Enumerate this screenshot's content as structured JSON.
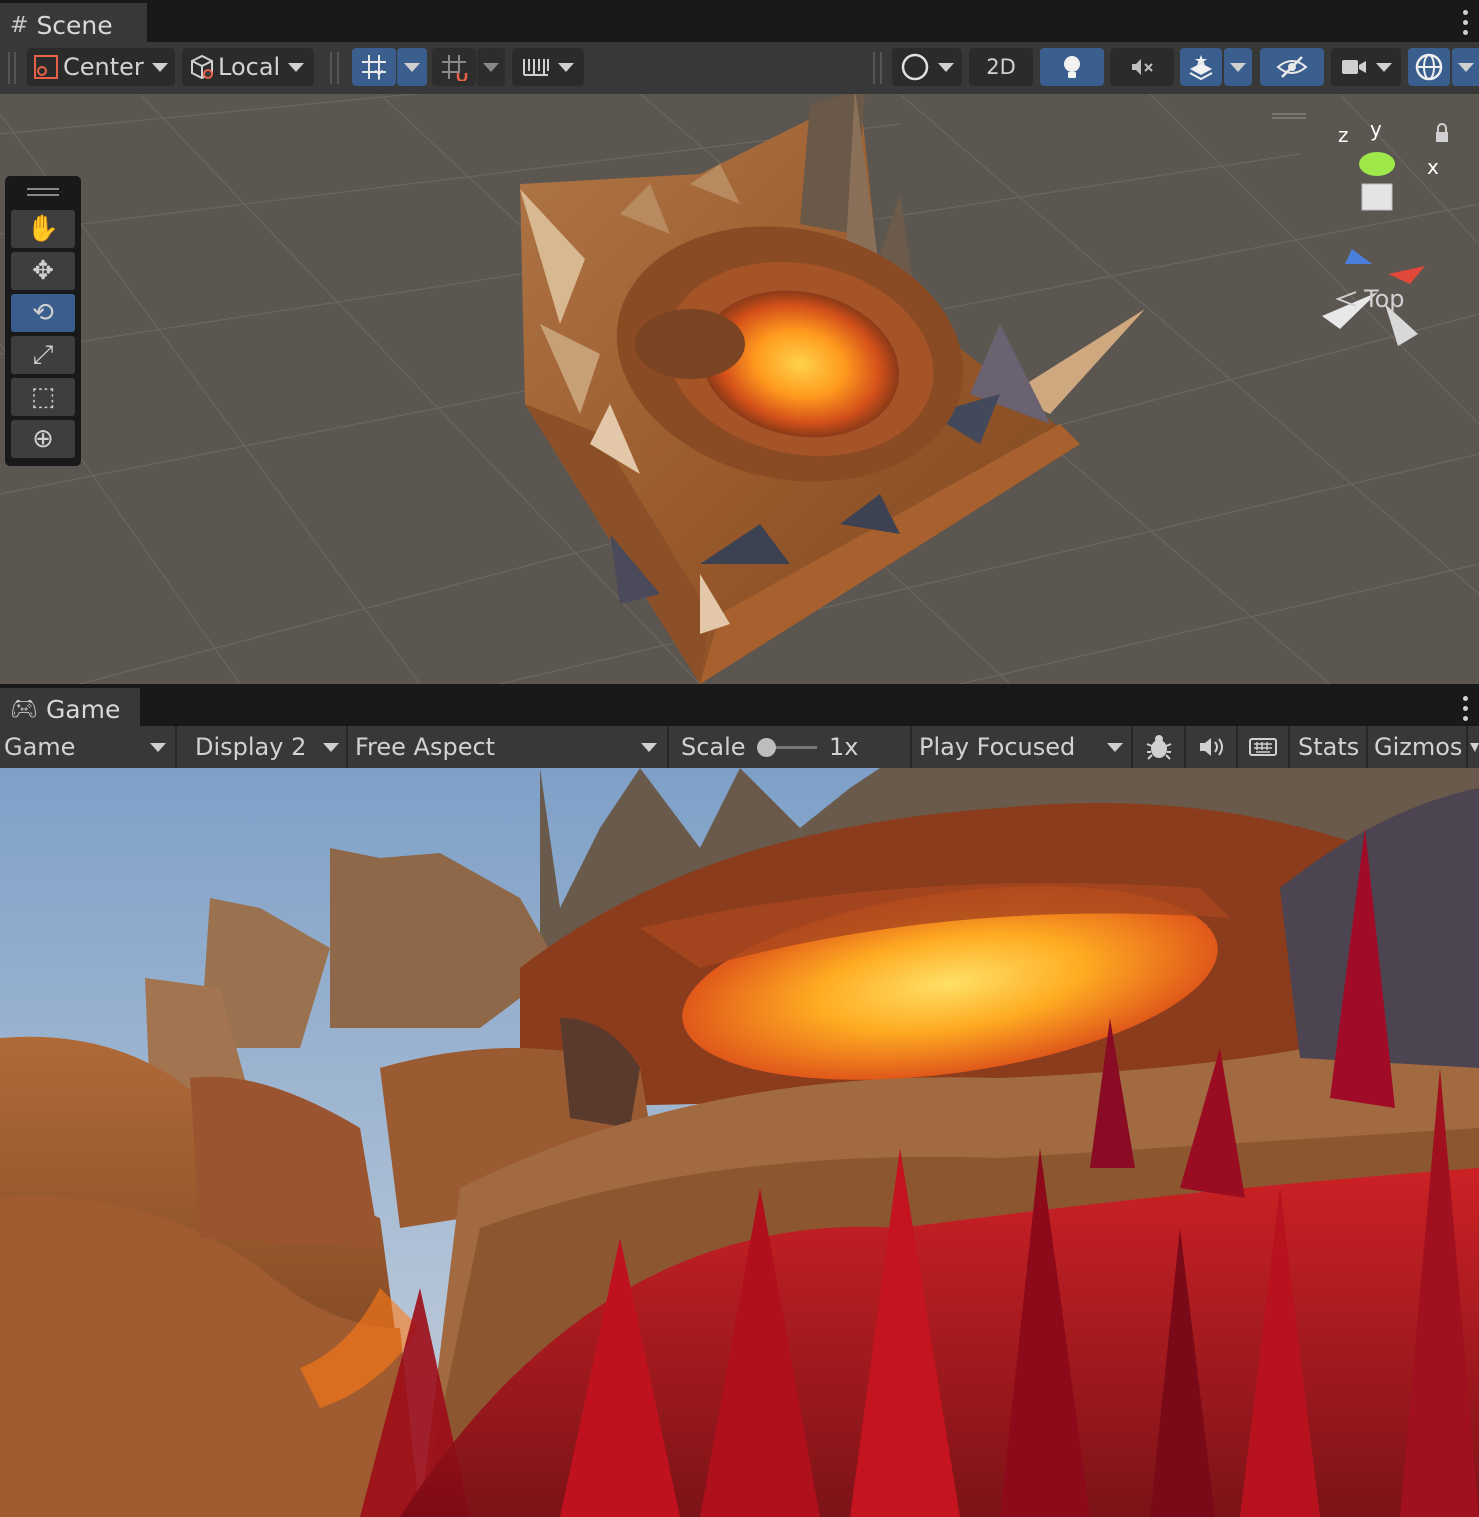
{
  "scene_panel": {
    "tab_label": "Scene",
    "tab_icon": "grid-icon",
    "toolbar": {
      "pivot_label": "Center",
      "space_label": "Local",
      "view_2d_label": "2D"
    },
    "tools": [
      "hand-tool",
      "move-tool",
      "rotate-tool",
      "scale-tool",
      "rect-tool",
      "transform-tool"
    ],
    "selected_tool": "rotate-tool",
    "gizmo": {
      "x": "x",
      "y": "y",
      "z": "z",
      "view_label": "Top"
    }
  },
  "game_panel": {
    "tab_label": "Game",
    "tab_icon": "gamepad-icon",
    "toolbar": {
      "view_mode": "Game",
      "display": "Display 2",
      "aspect": "Free Aspect",
      "scale_label": "Scale",
      "scale_value": "1x",
      "play_mode": "Play Focused",
      "stats_label": "Stats",
      "gizmos_label": "Gizmos"
    }
  },
  "colors": {
    "accent_blue": "#3a5f8e",
    "panel_bg": "#383838",
    "scene_bg": "#5c5650",
    "lava": "#ff9a20",
    "grass": "#c0101c"
  }
}
